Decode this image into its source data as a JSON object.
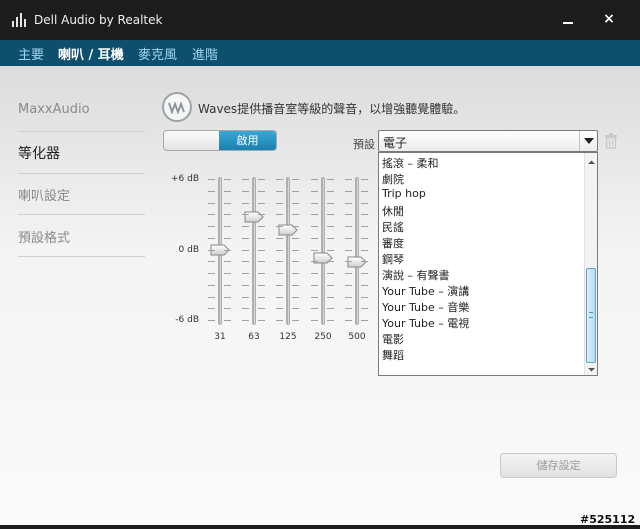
{
  "window": {
    "title": "Dell Audio by Realtek",
    "close_glyph": "×"
  },
  "nav": {
    "items": [
      "主要",
      "喇叭 / 耳機",
      "麥克風",
      "進階"
    ],
    "active_index": 1
  },
  "sidebar": {
    "items": [
      "MaxxAudio",
      "等化器",
      "喇叭設定",
      "預設格式"
    ],
    "active_index": 1
  },
  "waves": {
    "description": "Waves提供播音室等級的聲音，以增強聽覺體驗。"
  },
  "toggle": {
    "on_label": "啟用",
    "state": "on"
  },
  "preset": {
    "label": "預設",
    "selected": "電子"
  },
  "eq": {
    "db_labels": {
      "top": "+6 dB",
      "mid": "0 dB",
      "bottom": "-6 dB"
    },
    "db_range": [
      -6,
      6
    ],
    "bands": [
      {
        "freq": "31",
        "gain_db": 0
      },
      {
        "freq": "63",
        "gain_db": 2.8
      },
      {
        "freq": "125",
        "gain_db": 1.7
      },
      {
        "freq": "250",
        "gain_db": -0.7
      },
      {
        "freq": "500",
        "gain_db": -1.1
      }
    ]
  },
  "dropdown": {
    "items": [
      "搖滾 – 柔和",
      "劇院",
      "Trip hop",
      "休閒",
      "民謠",
      "審度",
      "鋼琴",
      "演說 – 有聲書",
      "Your Tube – 演講",
      "Your Tube – 音樂",
      "Your Tube – 電視",
      "電影",
      "舞蹈"
    ]
  },
  "save_button": {
    "label": "儲存設定",
    "enabled": false
  },
  "watermark": "#525112",
  "colors": {
    "accent": "#1b7fb0",
    "nav_bg": "#0f4f6e",
    "titlebar_bg": "#1c1c1c"
  }
}
